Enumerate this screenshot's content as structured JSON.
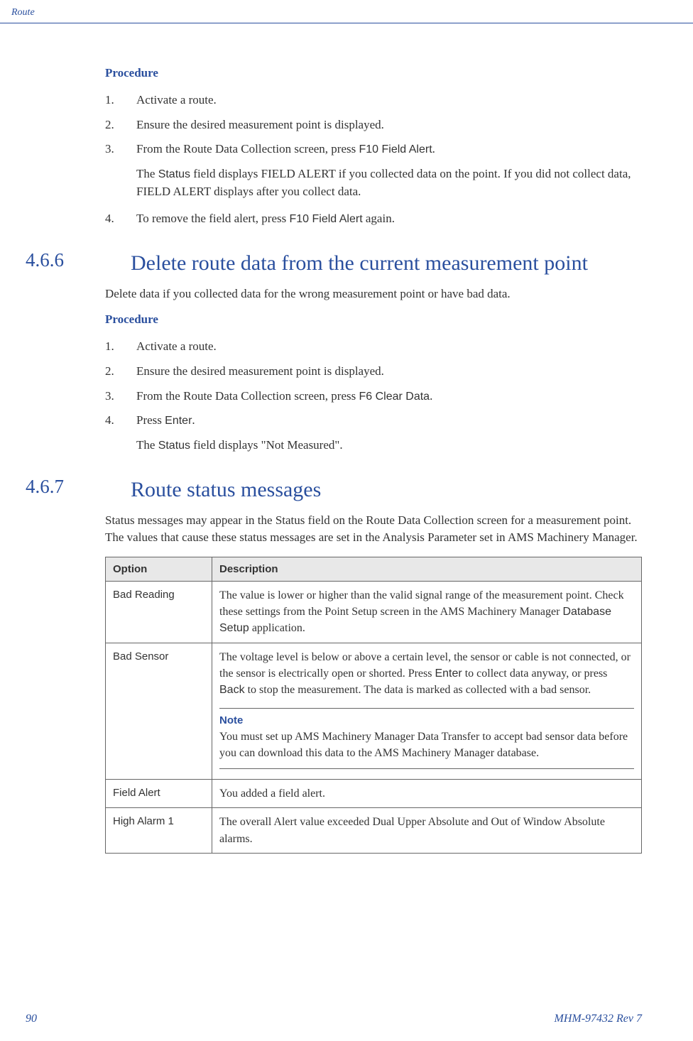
{
  "header": {
    "section_name": "Route"
  },
  "proc1": {
    "heading": "Procedure",
    "items": [
      {
        "num": "1.",
        "text_before": "Activate a route.",
        "term": "",
        "text_after": ""
      },
      {
        "num": "2.",
        "text_before": "Ensure the desired measurement point is displayed.",
        "term": "",
        "text_after": ""
      },
      {
        "num": "3.",
        "text_before": "From the Route Data Collection screen, press ",
        "term": "F10 Field Alert",
        "text_after": "."
      }
    ],
    "result_before": "The ",
    "result_term": "Status",
    "result_after": " field displays FIELD ALERT if you collected data on the point. If you did not collect data, FIELD ALERT displays after you collect data.",
    "items2": [
      {
        "num": "4.",
        "text_before": "To remove the field alert, press ",
        "term": "F10 Field Alert",
        "text_after": " again."
      }
    ]
  },
  "sec466": {
    "num": "4.6.6",
    "title": "Delete route data from the current measurement point",
    "intro": "Delete data if you collected data for the wrong measurement point or have bad data.",
    "proc_heading": "Procedure",
    "items": [
      {
        "num": "1.",
        "text_before": "Activate a route.",
        "term": "",
        "text_after": ""
      },
      {
        "num": "2.",
        "text_before": "Ensure the desired measurement point is displayed.",
        "term": "",
        "text_after": ""
      },
      {
        "num": "3.",
        "text_before": "From the Route Data Collection screen, press ",
        "term": "F6 Clear Data",
        "text_after": "."
      },
      {
        "num": "4.",
        "text_before": "Press ",
        "term": "Enter",
        "text_after": "."
      }
    ],
    "result_before": "The ",
    "result_term": "Status",
    "result_after": " field displays \"Not Measured\"."
  },
  "sec467": {
    "num": "4.6.7",
    "title": "Route status messages",
    "intro": "Status messages may appear in the Status field on the Route Data Collection screen for a measurement point. The values that cause these status messages are set in the Analysis Parameter set in AMS Machinery Manager.",
    "table": {
      "head_option": "Option",
      "head_desc": "Description",
      "rows": [
        {
          "option": "Bad Reading",
          "desc_before": "The value is lower or higher than the valid signal range of the measurement point. Check these settings from the Point Setup screen in the AMS Machinery Manager ",
          "desc_term": "Database Setup",
          "desc_after": " application."
        },
        {
          "option": "Bad Sensor",
          "desc_before": "The voltage level is below or above a certain level, the sensor or cable is not connected, or the sensor is electrically open or shorted. Press ",
          "desc_term1": "Enter",
          "desc_mid": " to collect data anyway, or press ",
          "desc_term2": "Back",
          "desc_after": " to stop the measurement. The data is marked as collected with a bad sensor.",
          "note_label": "Note",
          "note_text": "You must set up AMS Machinery Manager Data Transfer to accept bad sensor data before you can download this data to the AMS Machinery Manager database."
        },
        {
          "option": "Field Alert",
          "desc": "You added a field alert."
        },
        {
          "option": "High Alarm 1",
          "desc": "The overall Alert value exceeded Dual Upper Absolute and Out of Window Absolute alarms."
        }
      ]
    }
  },
  "footer": {
    "page": "90",
    "doc": "MHM-97432 Rev 7"
  }
}
